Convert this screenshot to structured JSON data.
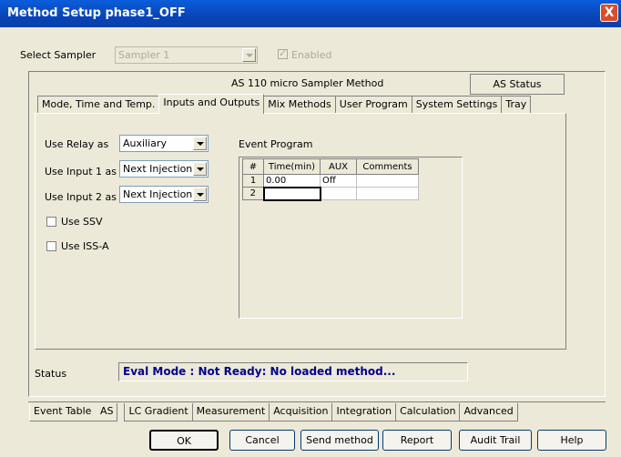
{
  "window": {
    "title": "Method Setup phase1_OFF",
    "close": "X"
  },
  "sampler": {
    "label": "Select Sampler",
    "value": "Sampler 1",
    "enabled_label": "Enabled"
  },
  "method_title": "AS 110 micro Sampler Method",
  "as_status_button": "AS Status",
  "top_tabs": [
    "Mode, Time and Temp.",
    "Inputs and Outputs",
    "Mix Methods",
    "User Program",
    "System Settings",
    "Tray"
  ],
  "fields": {
    "relay_label": "Use Relay as",
    "relay_value": "Auxiliary",
    "input1_label": "Use Input 1 as",
    "input1_value": "Next Injection",
    "input2_label": "Use Input 2 as",
    "input2_value": "Next Injection",
    "ssv_label": "Use SSV",
    "issa_label": "Use ISS-A"
  },
  "event_program": {
    "label": "Event Program",
    "headers": [
      "#",
      "Time(min)",
      "AUX",
      "Comments"
    ],
    "rows": [
      [
        "1",
        "0.00",
        "Off",
        ""
      ],
      [
        "2",
        "",
        "",
        ""
      ]
    ]
  },
  "status": {
    "label": "Status",
    "text": "Eval Mode : Not Ready: No loaded method..."
  },
  "bottom_tabs": [
    "Event Table",
    "AS",
    "LC Gradient",
    "Measurement",
    "Acquisition",
    "Integration",
    "Calculation",
    "Advanced"
  ],
  "buttons": {
    "ok": "OK",
    "cancel": "Cancel",
    "send": "Send method",
    "report": "Report",
    "audit": "Audit Trail",
    "help": "Help"
  }
}
